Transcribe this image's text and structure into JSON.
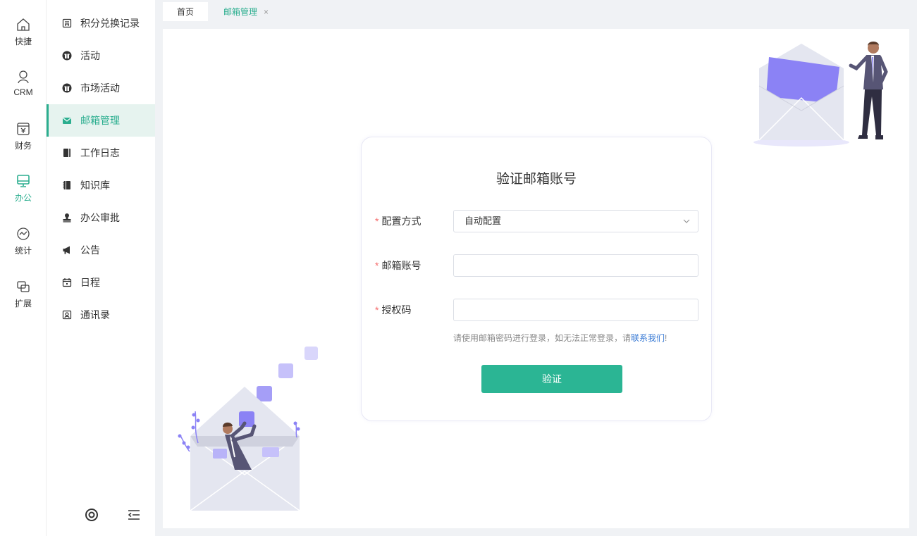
{
  "colors": {
    "accent": "#2bae8f",
    "button": "#2bb594",
    "required": "#f56c6c",
    "link": "#3a7bd5",
    "illustration": "#8b82f5"
  },
  "rail": {
    "items": [
      {
        "label": "快捷",
        "icon": "home-icon"
      },
      {
        "label": "CRM",
        "icon": "user-icon"
      },
      {
        "label": "财务",
        "icon": "finance-icon"
      },
      {
        "label": "办公",
        "icon": "monitor-icon",
        "active": true
      },
      {
        "label": "统计",
        "icon": "chart-circle-icon"
      },
      {
        "label": "扩展",
        "icon": "extend-icon"
      }
    ]
  },
  "menu": {
    "items": [
      {
        "label": "积分兑换记录",
        "icon": "points-record-icon"
      },
      {
        "label": "活动",
        "icon": "gift-icon"
      },
      {
        "label": "市场活动",
        "icon": "gift-icon"
      },
      {
        "label": "邮箱管理",
        "icon": "mail-icon",
        "active": true
      },
      {
        "label": "工作日志",
        "icon": "book-icon"
      },
      {
        "label": "知识库",
        "icon": "notebook-icon"
      },
      {
        "label": "办公审批",
        "icon": "stamp-icon"
      },
      {
        "label": "公告",
        "icon": "megaphone-icon"
      },
      {
        "label": "日程",
        "icon": "calendar-icon"
      },
      {
        "label": "通讯录",
        "icon": "contacts-icon"
      }
    ],
    "footer": {
      "settings_icon": "settings-icon",
      "collapse_icon": "collapse-menu-icon"
    }
  },
  "tabs": [
    {
      "label": "首页"
    },
    {
      "label": "邮箱管理",
      "active": true,
      "close": "×"
    }
  ],
  "form": {
    "title": "验证邮箱账号",
    "required_mark": "*",
    "config_label": "配置方式",
    "config_value": "自动配置",
    "account_label": "邮箱账号",
    "account_value": "",
    "auth_label": "授权码",
    "auth_value": "",
    "hint_text": "请使用邮箱密码进行登录，如无法正常登录，请",
    "hint_link": "联系我们",
    "hint_end": "!",
    "submit_label": "验证"
  }
}
